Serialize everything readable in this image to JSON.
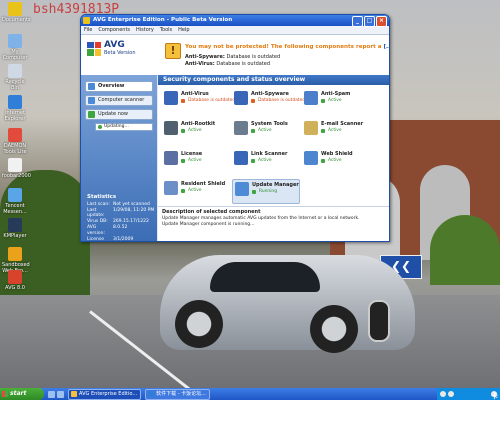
{
  "watermark": "bsh4391813P",
  "desktop_icons": [
    {
      "label": "Documents",
      "color": "#e9c31a"
    },
    {
      "label": "My Computer",
      "color": "#7fb2e8"
    },
    {
      "label": "Recycle Bin",
      "color": "#cfd9e6"
    },
    {
      "label": "Internet Explorer",
      "color": "#2f7fd8"
    },
    {
      "label": "DAEMON Tools Lite",
      "color": "#e24b3b"
    },
    {
      "label": "foobar2000",
      "color": "#f1f1f1"
    },
    {
      "label": "Tencent Messen...",
      "color": "#5aa5e8"
    },
    {
      "label": "KMPlayer",
      "color": "#283a5a"
    },
    {
      "label": "Sandboxed Web Bro...",
      "color": "#e9a21a"
    },
    {
      "label": "AVG 8.0",
      "color": "#d8432c"
    }
  ],
  "window": {
    "title": "AVG Enterprise Edition - Public Beta Version",
    "menu": [
      "File",
      "Components",
      "History",
      "Tools",
      "Help"
    ],
    "logo": {
      "name": "AVG",
      "subtitle": "Beta Version"
    },
    "warning": {
      "title": "You may not be protected! The following components report a",
      "link": "[...]",
      "rows": [
        {
          "label": "Anti-Spyware:",
          "value": "Database is outdated"
        },
        {
          "label": "Anti-Virus:",
          "value": "Database is outdated"
        }
      ]
    },
    "nav": {
      "overview": "Overview",
      "scanner": "Computer scanner",
      "update": "Update now",
      "updating": "Updating..."
    },
    "stats": {
      "title": "Statistics",
      "rows": [
        {
          "k": "Last scan:",
          "v": "Not yet scanned"
        },
        {
          "k": "Last update:",
          "v": "1/29/08, 11:20 PM"
        },
        {
          "k": "Virus DB:",
          "v": "269.15.17/1222"
        },
        {
          "k": "AVG version:",
          "v": "8.0.52"
        },
        {
          "k": "License expires:",
          "v": "3/1/2009"
        }
      ]
    },
    "section_title": "Security components and status overview",
    "components": [
      {
        "name": "Anti-Virus",
        "status": "Database is outdated",
        "state": "bad",
        "color": "#3a66b8"
      },
      {
        "name": "Anti-Spyware",
        "status": "Database is outdated",
        "state": "bad",
        "color": "#3a66b8"
      },
      {
        "name": "Anti-Spam",
        "status": "Active",
        "state": "ok",
        "color": "#4c7ec9"
      },
      {
        "name": "Anti-Rootkit",
        "status": "Active",
        "state": "ok",
        "color": "#50606f"
      },
      {
        "name": "System Tools",
        "status": "Active",
        "state": "ok",
        "color": "#6b7c8e"
      },
      {
        "name": "E-mail Scanner",
        "status": "Active",
        "state": "ok",
        "color": "#d0b15a"
      },
      {
        "name": "License",
        "status": "Active",
        "state": "ok",
        "color": "#5b6fa2"
      },
      {
        "name": "Link Scanner",
        "status": "Active",
        "state": "ok",
        "color": "#3a66b8"
      },
      {
        "name": "Web Shield",
        "status": "Active",
        "state": "ok",
        "color": "#4d86cf"
      },
      {
        "name": "Resident Shield",
        "status": "Active",
        "state": "ok",
        "color": "#6c8fc7"
      },
      {
        "name": "Update Manager",
        "status": "Running",
        "state": "ok",
        "color": "#4f8ad6"
      }
    ],
    "description": {
      "title": "Description of selected component",
      "line1": "Update Manager manages automatic AVG updates from the Internet or a local network.",
      "line2": "Update Manager component is running..."
    }
  },
  "taskbar": {
    "start": "start",
    "tasks": [
      {
        "label": "AVG Enterprise Editio...",
        "active": true
      },
      {
        "label": "软件下载 - 卡饭论坛...",
        "active": false
      }
    ],
    "tray_brand": "卡饭论坛"
  }
}
